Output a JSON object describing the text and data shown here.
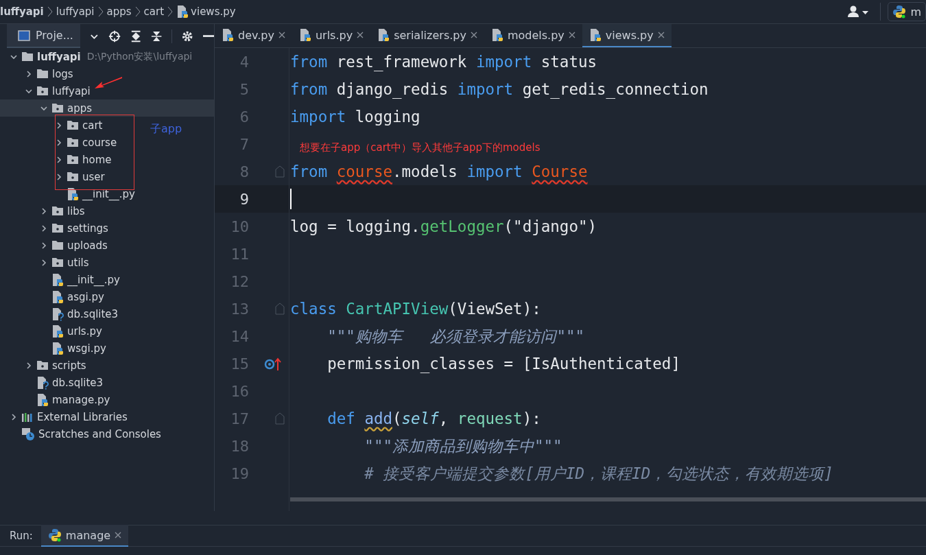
{
  "breadcrumbs": [
    {
      "label": "luffyapi",
      "bold": true
    },
    {
      "label": "luffyapi",
      "bold": false
    },
    {
      "label": "apps",
      "bold": false
    },
    {
      "label": "cart",
      "bold": false
    },
    {
      "label": "views.py",
      "bold": false,
      "kind": "pyfile"
    }
  ],
  "run_config": {
    "label": "m"
  },
  "project_panel": {
    "title": "Proje...",
    "tree": [
      {
        "label": "luffyapi",
        "hint": "D:\\Python安装\\luffyapi",
        "kind": "folder",
        "expanded": true,
        "selected": false,
        "children": [
          {
            "label": "logs",
            "kind": "folder",
            "expanded": false,
            "selected": false
          },
          {
            "label": "luffyapi",
            "kind": "package",
            "expanded": true,
            "selected": false,
            "children": [
              {
                "label": "apps",
                "kind": "package",
                "expanded": true,
                "selected": true,
                "children": [
                  {
                    "label": "cart",
                    "kind": "package",
                    "expanded": false,
                    "selected": false
                  },
                  {
                    "label": "course",
                    "kind": "package",
                    "expanded": false,
                    "selected": false
                  },
                  {
                    "label": "home",
                    "kind": "package",
                    "expanded": false,
                    "selected": false
                  },
                  {
                    "label": "user",
                    "kind": "package",
                    "expanded": false,
                    "selected": false
                  },
                  {
                    "label": "__init__.py",
                    "kind": "pyfile"
                  }
                ]
              },
              {
                "label": "libs",
                "kind": "package",
                "expanded": false,
                "selected": false
              },
              {
                "label": "settings",
                "kind": "package",
                "expanded": false,
                "selected": false
              },
              {
                "label": "uploads",
                "kind": "folder",
                "expanded": false,
                "selected": false
              },
              {
                "label": "utils",
                "kind": "package",
                "expanded": false,
                "selected": false
              },
              {
                "label": "__init__.py",
                "kind": "pyfile"
              },
              {
                "label": "asgi.py",
                "kind": "pyfile"
              },
              {
                "label": "db.sqlite3",
                "kind": "unknown"
              },
              {
                "label": "urls.py",
                "kind": "pyfile"
              },
              {
                "label": "wsgi.py",
                "kind": "pyfile"
              }
            ]
          },
          {
            "label": "scripts",
            "kind": "package",
            "expanded": false,
            "selected": false
          },
          {
            "label": "db.sqlite3",
            "kind": "unknown"
          },
          {
            "label": "manage.py",
            "kind": "pyfile"
          }
        ]
      },
      {
        "label": "External Libraries",
        "kind": "library",
        "expanded": false,
        "selected": false
      },
      {
        "label": "Scratches and Consoles",
        "kind": "scratches"
      }
    ]
  },
  "tree_annotation": {
    "label": "子app"
  },
  "tabs": [
    {
      "label": "dev.py",
      "selected": false
    },
    {
      "label": "urls.py",
      "selected": false
    },
    {
      "label": "serializers.py",
      "selected": false
    },
    {
      "label": "models.py",
      "selected": false
    },
    {
      "label": "views.py",
      "selected": true
    }
  ],
  "editor": {
    "annotation": "想要在子app（cart中）导入其他子app下的models",
    "lines": [
      {
        "number": "4",
        "tokens": [
          {
            "text": "from",
            "kind": "kw"
          },
          {
            "text": " rest_framework ",
            "kind": "plain"
          },
          {
            "text": "import",
            "kind": "kw"
          },
          {
            "text": " status",
            "kind": "plain"
          }
        ]
      },
      {
        "number": "5",
        "tokens": [
          {
            "text": "from",
            "kind": "kw"
          },
          {
            "text": " django_redis ",
            "kind": "plain"
          },
          {
            "text": "import",
            "kind": "kw"
          },
          {
            "text": " get_redis_connection",
            "kind": "plain"
          }
        ]
      },
      {
        "number": "6",
        "tokens": [
          {
            "text": "import",
            "kind": "kw"
          },
          {
            "text": " logging",
            "kind": "plain"
          }
        ]
      },
      {
        "number": "7"
      },
      {
        "number": "8",
        "fold": true,
        "tokens": [
          {
            "text": "from ",
            "kind": "kw"
          },
          {
            "text": "course",
            "kind": "err"
          },
          {
            "text": ".models ",
            "kind": "plain"
          },
          {
            "text": "import ",
            "kind": "kw"
          },
          {
            "text": "Course",
            "kind": "err"
          }
        ]
      },
      {
        "number": "9",
        "current": true
      },
      {
        "number": "10",
        "tokens": [
          {
            "text": "log = logging.",
            "kind": "plain"
          },
          {
            "text": "getLogger",
            "kind": "fn"
          },
          {
            "text": "(\"django\")",
            "kind": "plain"
          }
        ]
      },
      {
        "number": "11"
      },
      {
        "number": "12"
      },
      {
        "number": "13",
        "fold": true,
        "tokens": [
          {
            "text": "class ",
            "kind": "kw"
          },
          {
            "text": "CartAPIView",
            "kind": "cls"
          },
          {
            "text": "(ViewSet):",
            "kind": "plain"
          }
        ]
      },
      {
        "number": "14",
        "tokens": [
          {
            "text": "    \"\"\"购物车   必须登录才能访问\"\"\"",
            "kind": "doc"
          }
        ]
      },
      {
        "number": "15",
        "override": true,
        "tokens": [
          {
            "text": "    permission_classes = [IsAuthenticated]",
            "kind": "plain"
          }
        ]
      },
      {
        "number": "16"
      },
      {
        "number": "17",
        "fold": true,
        "tokens": [
          {
            "text": "    def ",
            "kind": "kw"
          },
          {
            "text": "add",
            "kind": "warn"
          },
          {
            "text": "(",
            "kind": "plain"
          },
          {
            "text": "self",
            "kind": "self"
          },
          {
            "text": ", ",
            "kind": "plain"
          },
          {
            "text": "request",
            "kind": "param"
          },
          {
            "text": "):",
            "kind": "plain"
          }
        ]
      },
      {
        "number": "18",
        "tokens": [
          {
            "text": "        \"\"\"添加商品到购物车中\"\"\"",
            "kind": "doc"
          }
        ]
      },
      {
        "number": "19",
        "tokens": [
          {
            "text": "        # 接受客户端提交参数[用户ID，课程ID，勾选状态，有效期选项]",
            "kind": "comment"
          }
        ]
      }
    ]
  },
  "run_panel": {
    "label": "Run:",
    "tabs": [
      {
        "label": "manage",
        "selected": true
      }
    ]
  }
}
